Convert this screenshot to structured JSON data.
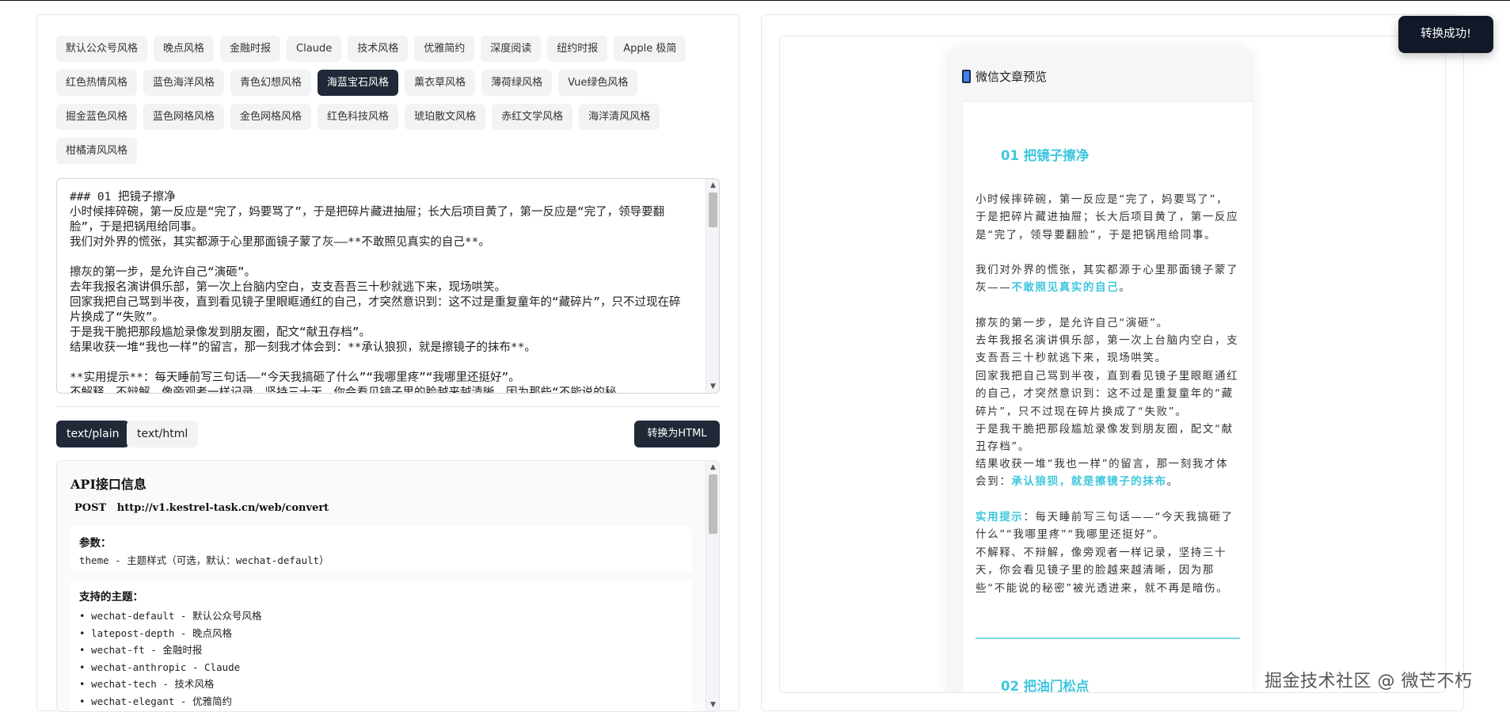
{
  "themes": [
    [
      "默认公众号风格",
      "晚点风格",
      "金融时报",
      "Claude",
      "技术风格",
      "优雅简约",
      "深度阅读",
      "纽约时报",
      "Apple 极简"
    ],
    [
      "红色热情风格",
      "蓝色海洋风格",
      "青色幻想风格",
      "海蓝宝石风格",
      "薰衣草风格",
      "薄荷绿风格",
      "Vue绿色风格"
    ],
    [
      "掘金蓝色风格",
      "蓝色网格风格",
      "金色网格风格",
      "红色科技风格",
      "琥珀散文风格",
      "赤红文学风格",
      "海洋清风风格"
    ],
    [
      "柑橘清风风格"
    ]
  ],
  "active_theme": "海蓝宝石风格",
  "editor": {
    "lines": [
      "### 01 把镜子擦净",
      "小时候摔碎碗，第一反应是“完了，妈要骂了”，于是把碎片藏进抽屉；长大后项目黄了，第一反应是“完了，领导要翻脸”，于是把锅甩给同事。",
      "我们对外界的慌张，其实都源于心里那面镜子蒙了灰——**不敢照见真实的自己**。",
      "",
      "擦灰的第一步，是允许自己“演砸”。",
      "去年我报名演讲俱乐部，第一次上台脑内空白，支支吾吾三十秒就逃下来，现场哄笑。",
      "回家我把自己骂到半夜，直到看见镜子里眼眶通红的自己，才突然意识到：这不过是重复童年的“藏碎片”，只不过现在碎片换成了“失败”。",
      "于是我干脆把那段尴尬录像发到朋友圈，配文“献丑存档”。",
      "结果收获一堆“我也一样”的留言，那一刻我才体会到：**承认狼狈，就是擦镜子的抹布**。",
      "",
      "**实用提示**：每天睡前写三句话——“今天我搞砸了什么”“我哪里疼”“我哪里还挺好”。",
      "不解释、不辩解，像旁观者一样记录，坚持三十天，你会看见镜子里的脸越来越清晰，因为那些“不能说的秘"
    ]
  },
  "format_tabs": [
    "text/plain",
    "text/html"
  ],
  "active_format": "text/plain",
  "convert_label": "转换为HTML",
  "api": {
    "title": "API接口信息",
    "method": "POST",
    "url": "http://v1.kestrel-task.cn/web/convert",
    "params_head": "参数：",
    "params_line": "theme - 主题样式（可选，默认：wechat-default）",
    "themes_head": "支持的主题：",
    "theme_lines": [
      "• wechat-default - 默认公众号风格",
      "• latepost-depth - 晚点风格",
      "• wechat-ft - 金融时报",
      "• wechat-anthropic - Claude",
      "• wechat-tech - 技术风格",
      "• wechat-elegant - 优雅简约"
    ]
  },
  "preview": {
    "header": "微信文章预览",
    "h1": "01 把镜子擦净",
    "p1": "小时候摔碎碗，第一反应是“完了，妈要骂了”，于是把碎片藏进抽屉；长大后项目黄了，第一反应是“完了，领导要翻脸”，于是把锅甩给同事。",
    "p2_pre": "我们对外界的慌张，其实都源于心里那面镜子蒙了灰——",
    "p2_hl": "不敢照见真实的自己",
    "p2_post": "。",
    "p3": "擦灰的第一步，是允许自己“演砸”。",
    "p4": "去年我报名演讲俱乐部，第一次上台脑内空白，支支吾吾三十秒就逃下来，现场哄笑。",
    "p5": "回家我把自己骂到半夜，直到看见镜子里眼眶通红的自己，才突然意识到：这不过是重复童年的“藏碎片”，只不过现在碎片换成了“失败”。",
    "p6": "于是我干脆把那段尴尬录像发到朋友圈，配文“献丑存档”。",
    "p7_pre": "结果收获一堆“我也一样”的留言，那一刻我才体会到：",
    "p7_hl": "承认狼狈，就是擦镜子的抹布",
    "p7_post": "。",
    "p8_hl": "实用提示",
    "p8_post": "：每天睡前写三句话——“今天我搞砸了什么”“我哪里疼”“我哪里还挺好”。",
    "p9": "不解释、不辩解，像旁观者一样记录，坚持三十天，你会看见镜子里的脸越来越清晰，因为那些“不能说的秘密”被光透进来，就不再是暗伤。",
    "h2": "02 把油门松点"
  },
  "toast": "转换成功!",
  "watermark": "掘金技术社区 @ 微芒不朽",
  "colors": {
    "accent": "#3ec6dd",
    "dark_button": "#1f2937"
  }
}
